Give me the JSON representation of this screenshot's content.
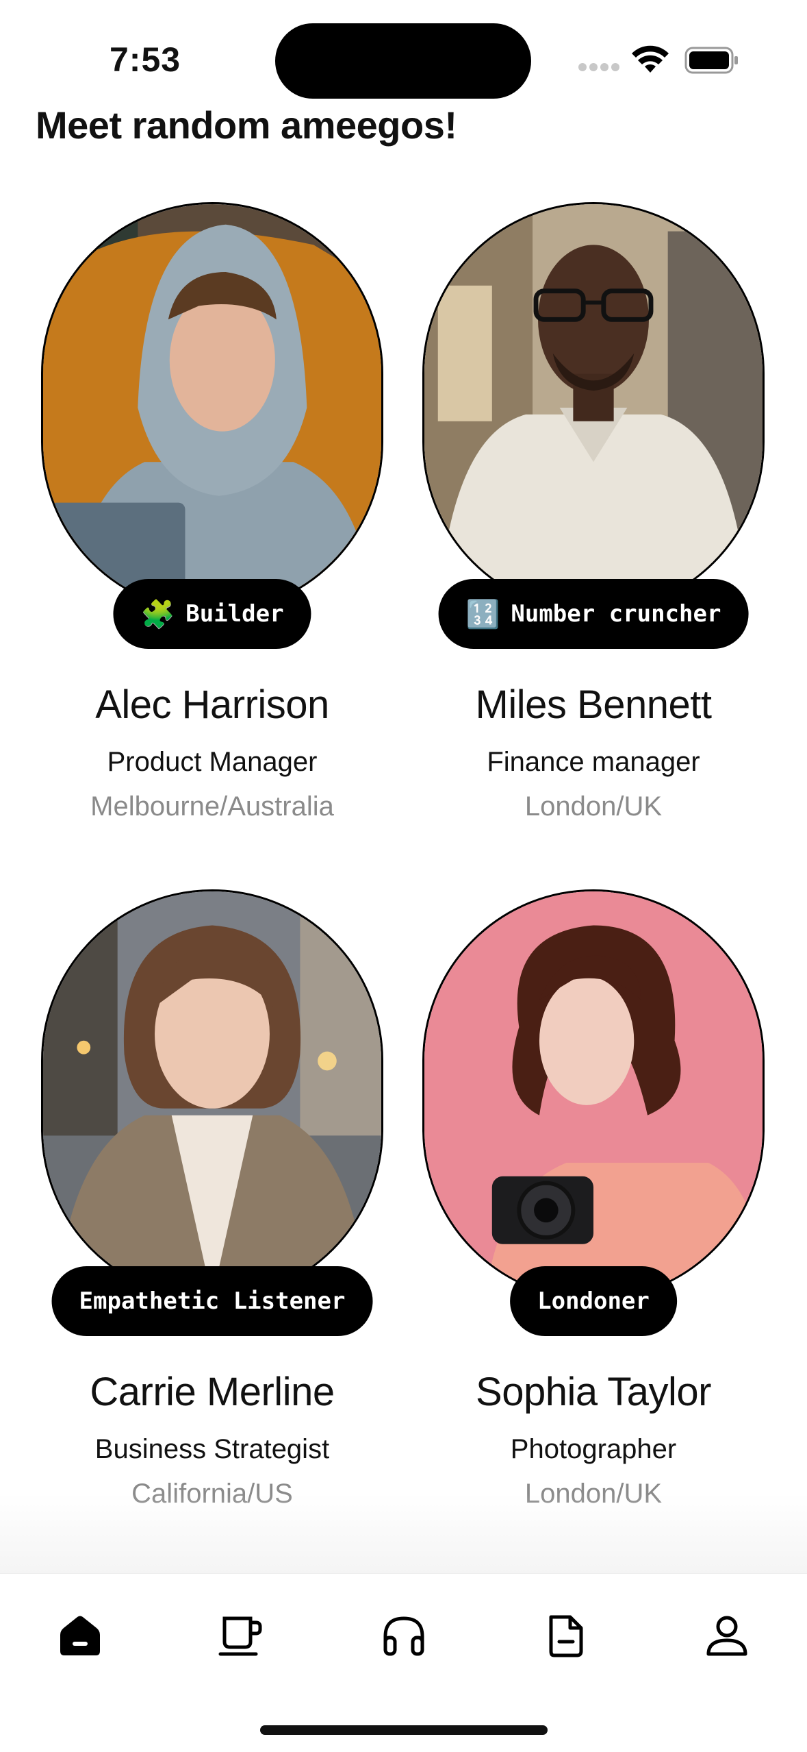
{
  "status_bar": {
    "time": "7:53"
  },
  "page": {
    "title": "Meet random ameegos!"
  },
  "people": [
    {
      "tag_icon": "🧩",
      "tag": "Builder",
      "name": "Alec Harrison",
      "role": "Product Manager",
      "location": "Melbourne/Australia"
    },
    {
      "tag_icon": "🔢",
      "tag": "Number cruncher",
      "name": "Miles Bennett",
      "role": "Finance manager",
      "location": "London/UK"
    },
    {
      "tag_icon": "",
      "tag": "Empathetic Listener",
      "name": "Carrie Merline",
      "role": "Business Strategist",
      "location": "California/US"
    },
    {
      "tag_icon": "",
      "tag": "Londoner",
      "name": "Sophia Taylor",
      "role": "Photographer",
      "location": "London/UK"
    }
  ],
  "tab_bar": {
    "icons": [
      "home-icon",
      "coffee-cup-icon",
      "headphones-icon",
      "document-icon",
      "profile-icon"
    ]
  }
}
